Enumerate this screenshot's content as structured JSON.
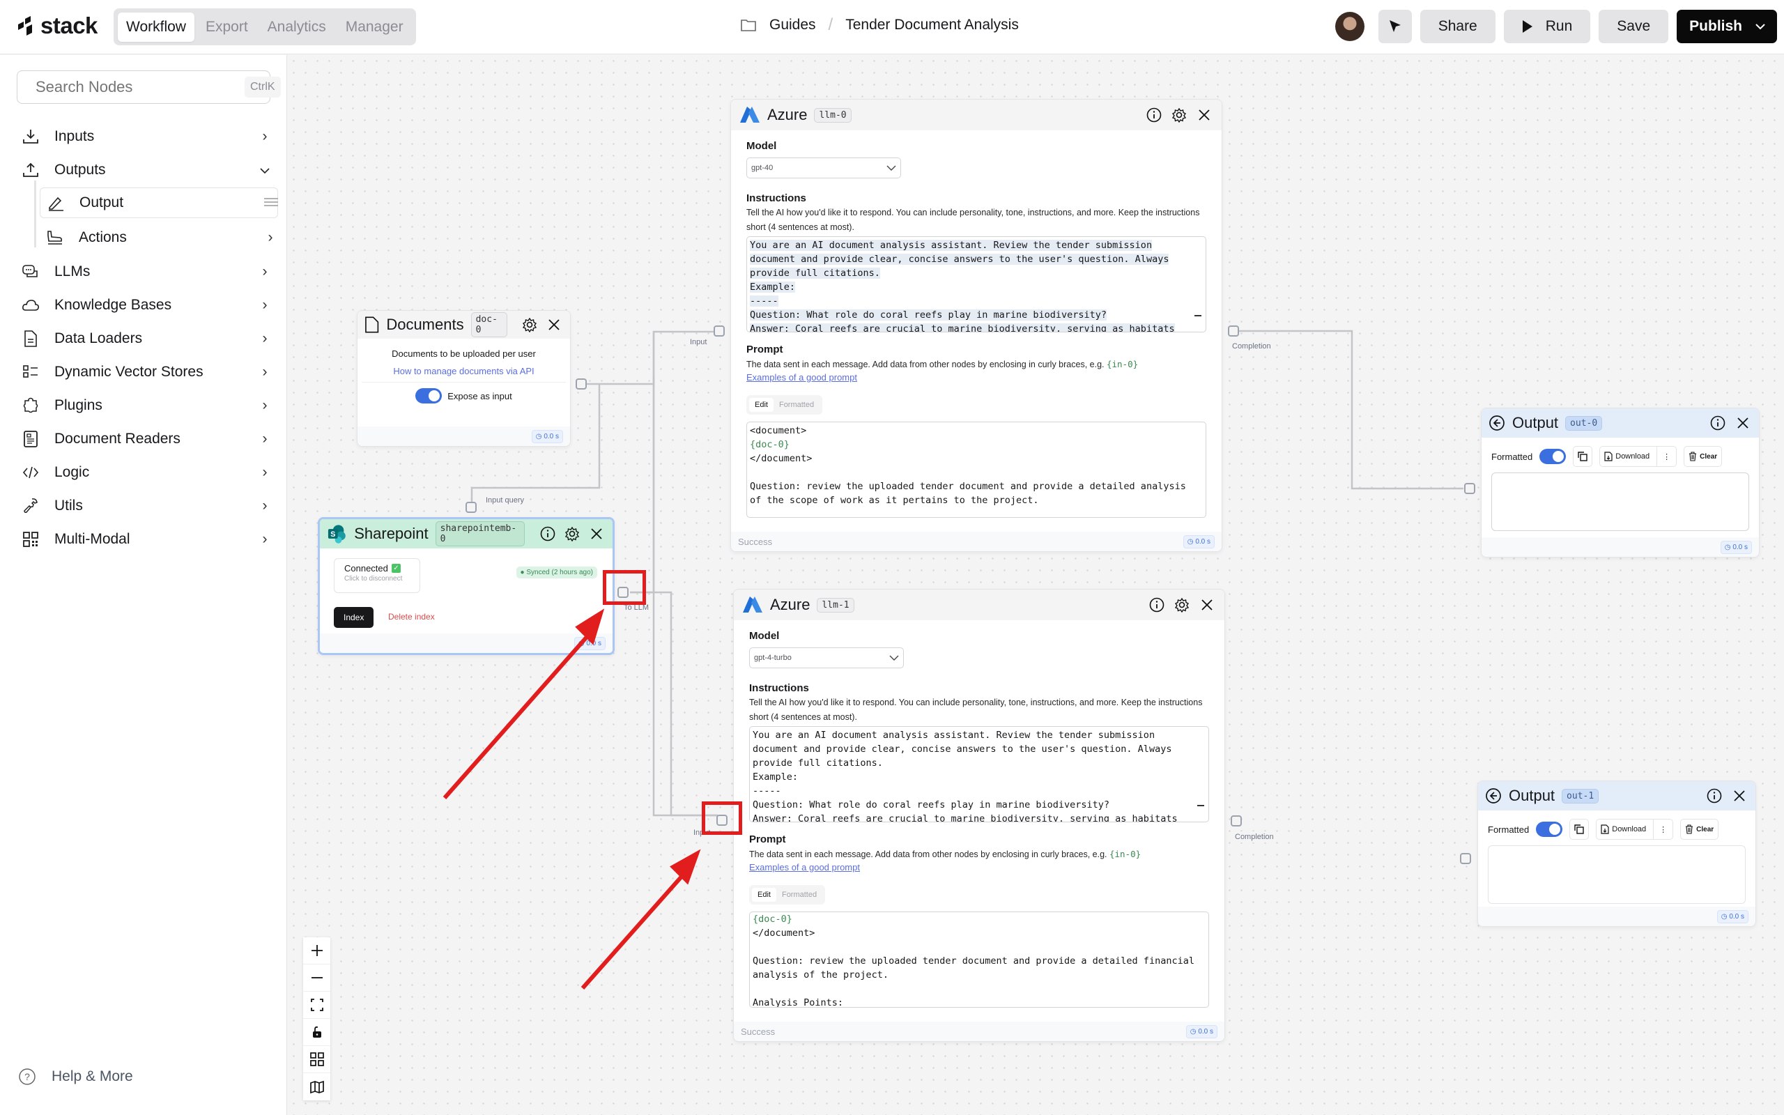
{
  "app": {
    "logo": "stack",
    "tabs": [
      {
        "label": "Workflow",
        "active": true
      },
      {
        "label": "Export",
        "active": false
      },
      {
        "label": "Analytics",
        "active": false
      },
      {
        "label": "Manager",
        "active": false
      }
    ],
    "breadcrumb": {
      "folder": "Guides",
      "project": "Tender Document Analysis"
    },
    "actions": {
      "share": "Share",
      "run": "Run",
      "save": "Save",
      "publish": "Publish"
    }
  },
  "sidebar": {
    "search": {
      "placeholder": "Search Nodes",
      "shortcut": "CtrlK"
    },
    "items": [
      {
        "label": "Inputs",
        "icon": "download-icon",
        "state": "collapsed"
      },
      {
        "label": "Outputs",
        "icon": "upload-icon",
        "state": "expanded"
      },
      {
        "label": "Output",
        "icon": "pencil-icon",
        "state": "selected-sub"
      },
      {
        "label": "Actions",
        "icon": "plane-landing-icon",
        "state": "collapsed-sub"
      },
      {
        "label": "LLMs",
        "icon": "chat-icon",
        "state": "collapsed"
      },
      {
        "label": "Knowledge Bases",
        "icon": "cloud-icon",
        "state": "collapsed"
      },
      {
        "label": "Data Loaders",
        "icon": "file-icon",
        "state": "collapsed"
      },
      {
        "label": "Dynamic Vector Stores",
        "icon": "list-icon",
        "state": "collapsed"
      },
      {
        "label": "Plugins",
        "icon": "puzzle-icon",
        "state": "collapsed"
      },
      {
        "label": "Document Readers",
        "icon": "document-reader-icon",
        "state": "collapsed"
      },
      {
        "label": "Logic",
        "icon": "code-icon",
        "state": "collapsed"
      },
      {
        "label": "Utils",
        "icon": "wrench-icon",
        "state": "collapsed"
      },
      {
        "label": "Multi-Modal",
        "icon": "qr-icon",
        "state": "collapsed"
      }
    ],
    "help": "Help & More"
  },
  "nodes": {
    "documents": {
      "title": "Documents",
      "tag": "doc-0",
      "description": "Documents to be uploaded per user",
      "link": "How to manage documents via API",
      "toggle_label": "Expose as input",
      "toggle_on": true,
      "timer": "0.0 s"
    },
    "sharepoint": {
      "title": "Sharepoint",
      "tag": "sharepointemb-0",
      "connected_label": "Connected",
      "connected_sub": "Click to disconnect",
      "sync_status": "Synced (2 hours ago)",
      "index_button": "Index",
      "delete_button": "Delete index",
      "timer": "0.0 s",
      "input_handle_label": "Input query",
      "output_handle_label": "To LLM"
    },
    "llm0": {
      "title": "Azure",
      "tag": "llm-0",
      "model_label": "Model",
      "model_value": "gpt-40",
      "instructions_label": "Instructions",
      "instructions_help": "Tell the AI how you'd like it to respond. You can include personality, tone, instructions, and more. Keep the instructions short (4 sentences at most).",
      "instructions_lines": [
        "You are an AI document analysis assistant. Review the tender submission",
        "document and provide clear, concise answers to the user's question. Always",
        "provide full citations.",
        "Example:",
        "-----",
        "Question: What role do coral reefs play in marine biodiversity?",
        "Answer: Coral reefs are crucial to marine biodiversity, serving as habitats"
      ],
      "prompt_label": "Prompt",
      "prompt_help": "The data sent in each message. Add data from other nodes by enclosing in curly braces, e.g.",
      "prompt_help_var": "{in-0}",
      "prompt_link": "Examples of a good prompt",
      "tab_edit": "Edit",
      "tab_formatted": "Formatted",
      "prompt_lines": [
        {
          "text": "<document>",
          "var": false
        },
        {
          "text": "{doc-0}",
          "var": true
        },
        {
          "text": "</document>",
          "var": false
        },
        {
          "text": "",
          "var": false
        },
        {
          "text": "Question: review the uploaded tender document and provide a detailed analysis",
          "var": false
        },
        {
          "text": "of the scope of work as it pertains to the project.",
          "var": false
        }
      ],
      "status": "Success",
      "timer": "0.0 s",
      "input_handle_label": "Input",
      "output_handle_label": "Completion"
    },
    "llm1": {
      "title": "Azure",
      "tag": "llm-1",
      "model_label": "Model",
      "model_value": "gpt-4-turbo",
      "instructions_label": "Instructions",
      "instructions_help": "Tell the AI how you'd like it to respond. You can include personality, tone, instructions, and more. Keep the instructions short (4 sentences at most).",
      "instructions_lines": [
        "You are an AI document analysis assistant. Review the tender submission",
        "document and provide clear, concise answers to the user's question. Always",
        "provide full citations.",
        "Example:",
        "-----",
        "Question: What role do coral reefs play in marine biodiversity?",
        "Answer: Coral reefs are crucial to marine biodiversity, serving as habitats"
      ],
      "prompt_label": "Prompt",
      "prompt_help": "The data sent in each message. Add data from other nodes by enclosing in curly braces, e.g.",
      "prompt_help_var": "{in-0}",
      "prompt_link": "Examples of a good prompt",
      "tab_edit": "Edit",
      "tab_formatted": "Formatted",
      "prompt_lines": [
        {
          "text": "{doc-0}",
          "var": true
        },
        {
          "text": "</document>",
          "var": false
        },
        {
          "text": "",
          "var": false
        },
        {
          "text": "Question: review the uploaded tender document and provide a detailed financial",
          "var": false
        },
        {
          "text": "analysis of the project.",
          "var": false
        },
        {
          "text": "",
          "var": false
        },
        {
          "text": "Analysis Points:",
          "var": false
        }
      ],
      "status": "Success",
      "timer": "0.0 s",
      "input_handle_label": "Input",
      "output_handle_label": "Completion"
    },
    "out0": {
      "title": "Output",
      "tag": "out-0",
      "formatted_label": "Formatted",
      "formatted_on": true,
      "download": "Download",
      "clear": "Clear",
      "content": "",
      "timer": "0.0 s"
    },
    "out1": {
      "title": "Output",
      "tag": "out-1",
      "formatted_label": "Formatted",
      "formatted_on": true,
      "download": "Download",
      "clear": "Clear",
      "content": "",
      "timer": "0.0 s"
    }
  },
  "colors": {
    "accent_blue": "#3b6fe0",
    "annotation_red": "#e11d1d",
    "sharepoint_header": "#c9eedb",
    "output_header": "#e3edf9"
  }
}
